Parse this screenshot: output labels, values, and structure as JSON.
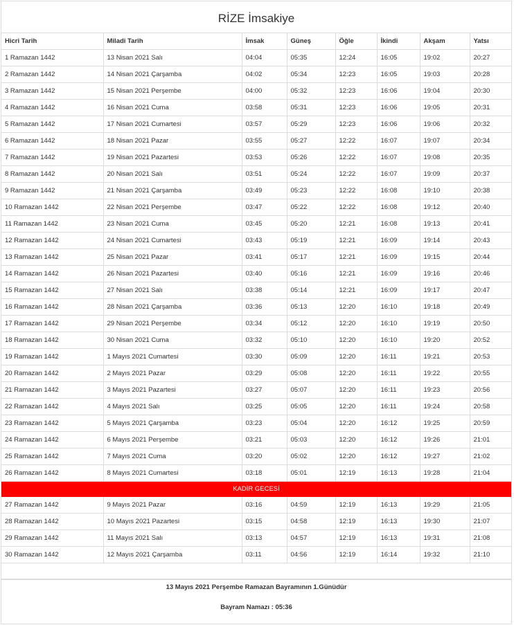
{
  "title": "RİZE İmsakiye",
  "columns": [
    "Hicri Tarih",
    "Miladi Tarih",
    "İmsak",
    "Güneş",
    "Öğle",
    "İkindi",
    "Akşam",
    "Yatsı"
  ],
  "rows_before": [
    [
      "1 Ramazan 1442",
      "13 Nisan 2021 Salı",
      "04:04",
      "05:35",
      "12:24",
      "16:05",
      "19:02",
      "20:27"
    ],
    [
      "2 Ramazan 1442",
      "14 Nisan 2021 Çarşamba",
      "04:02",
      "05:34",
      "12:23",
      "16:05",
      "19:03",
      "20:28"
    ],
    [
      "3 Ramazan 1442",
      "15 Nisan 2021 Perşembe",
      "04:00",
      "05:32",
      "12:23",
      "16:06",
      "19:04",
      "20:30"
    ],
    [
      "4 Ramazan 1442",
      "16 Nisan 2021 Cuma",
      "03:58",
      "05:31",
      "12:23",
      "16:06",
      "19:05",
      "20:31"
    ],
    [
      "5 Ramazan 1442",
      "17 Nisan 2021 Cumartesi",
      "03:57",
      "05:29",
      "12:23",
      "16:06",
      "19:06",
      "20:32"
    ],
    [
      "6 Ramazan 1442",
      "18 Nisan 2021 Pazar",
      "03:55",
      "05:27",
      "12:22",
      "16:07",
      "19:07",
      "20:34"
    ],
    [
      "7 Ramazan 1442",
      "19 Nisan 2021 Pazartesi",
      "03:53",
      "05:26",
      "12:22",
      "16:07",
      "19:08",
      "20:35"
    ],
    [
      "8 Ramazan 1442",
      "20 Nisan 2021 Salı",
      "03:51",
      "05:24",
      "12:22",
      "16:07",
      "19:09",
      "20:37"
    ],
    [
      "9 Ramazan 1442",
      "21 Nisan 2021 Çarşamba",
      "03:49",
      "05:23",
      "12:22",
      "16:08",
      "19:10",
      "20:38"
    ],
    [
      "10 Ramazan 1442",
      "22 Nisan 2021 Perşembe",
      "03:47",
      "05:22",
      "12:22",
      "16:08",
      "19:12",
      "20:40"
    ],
    [
      "11 Ramazan 1442",
      "23 Nisan 2021 Cuma",
      "03:45",
      "05:20",
      "12:21",
      "16:08",
      "19:13",
      "20:41"
    ],
    [
      "12 Ramazan 1442",
      "24 Nisan 2021 Cumartesi",
      "03:43",
      "05:19",
      "12:21",
      "16:09",
      "19:14",
      "20:43"
    ],
    [
      "13 Ramazan 1442",
      "25 Nisan 2021 Pazar",
      "03:41",
      "05:17",
      "12:21",
      "16:09",
      "19:15",
      "20:44"
    ],
    [
      "14 Ramazan 1442",
      "26 Nisan 2021 Pazartesi",
      "03:40",
      "05:16",
      "12:21",
      "16:09",
      "19:16",
      "20:46"
    ],
    [
      "15 Ramazan 1442",
      "27 Nisan 2021 Salı",
      "03:38",
      "05:14",
      "12:21",
      "16:09",
      "19:17",
      "20:47"
    ],
    [
      "16 Ramazan 1442",
      "28 Nisan 2021 Çarşamba",
      "03:36",
      "05:13",
      "12:20",
      "16:10",
      "19:18",
      "20:49"
    ],
    [
      "17 Ramazan 1442",
      "29 Nisan 2021 Perşembe",
      "03:34",
      "05:12",
      "12:20",
      "16:10",
      "19:19",
      "20:50"
    ],
    [
      "18 Ramazan 1442",
      "30 Nisan 2021 Cuma",
      "03:32",
      "05:10",
      "12:20",
      "16:10",
      "19:20",
      "20:52"
    ],
    [
      "19 Ramazan 1442",
      "1 Mayıs 2021 Cumartesi",
      "03:30",
      "05:09",
      "12:20",
      "16:11",
      "19:21",
      "20:53"
    ],
    [
      "20 Ramazan 1442",
      "2 Mayıs 2021 Pazar",
      "03:29",
      "05:08",
      "12:20",
      "16:11",
      "19:22",
      "20:55"
    ],
    [
      "21 Ramazan 1442",
      "3 Mayıs 2021 Pazartesi",
      "03:27",
      "05:07",
      "12:20",
      "16:11",
      "19:23",
      "20:56"
    ],
    [
      "22 Ramazan 1442",
      "4 Mayıs 2021 Salı",
      "03:25",
      "05:05",
      "12:20",
      "16:11",
      "19:24",
      "20:58"
    ],
    [
      "23 Ramazan 1442",
      "5 Mayıs 2021 Çarşamba",
      "03:23",
      "05:04",
      "12:20",
      "16:12",
      "19:25",
      "20:59"
    ],
    [
      "24 Ramazan 1442",
      "6 Mayıs 2021 Perşembe",
      "03:21",
      "05:03",
      "12:20",
      "16:12",
      "19:26",
      "21:01"
    ],
    [
      "25 Ramazan 1442",
      "7 Mayıs 2021 Cuma",
      "03:20",
      "05:02",
      "12:20",
      "16:12",
      "19:27",
      "21:02"
    ],
    [
      "26 Ramazan 1442",
      "8 Mayıs 2021 Cumartesi",
      "03:18",
      "05:01",
      "12:19",
      "16:13",
      "19:28",
      "21:04"
    ]
  ],
  "special_row": "KADİR GECESİ",
  "rows_after": [
    [
      "27 Ramazan 1442",
      "9 Mayıs 2021 Pazar",
      "03:16",
      "04:59",
      "12:19",
      "16:13",
      "19:29",
      "21:05"
    ],
    [
      "28 Ramazan 1442",
      "10 Mayıs 2021 Pazartesi",
      "03:15",
      "04:58",
      "12:19",
      "16:13",
      "19:30",
      "21:07"
    ],
    [
      "29 Ramazan 1442",
      "11 Mayıs 2021 Salı",
      "03:13",
      "04:57",
      "12:19",
      "16:13",
      "19:31",
      "21:08"
    ],
    [
      "30 Ramazan 1442",
      "12 Mayıs 2021 Çarşamba",
      "03:11",
      "04:56",
      "12:19",
      "16:14",
      "19:32",
      "21:10"
    ]
  ],
  "footer": {
    "line1": "13 Mayıs 2021 Perşembe Ramazan Bayramının 1.Günüdür",
    "line2": "Bayram Namazı : 05:36"
  },
  "colors": {
    "special_row_bg": "#ff0000",
    "special_row_text": "#ffffff",
    "border": "#dcdcdc"
  }
}
